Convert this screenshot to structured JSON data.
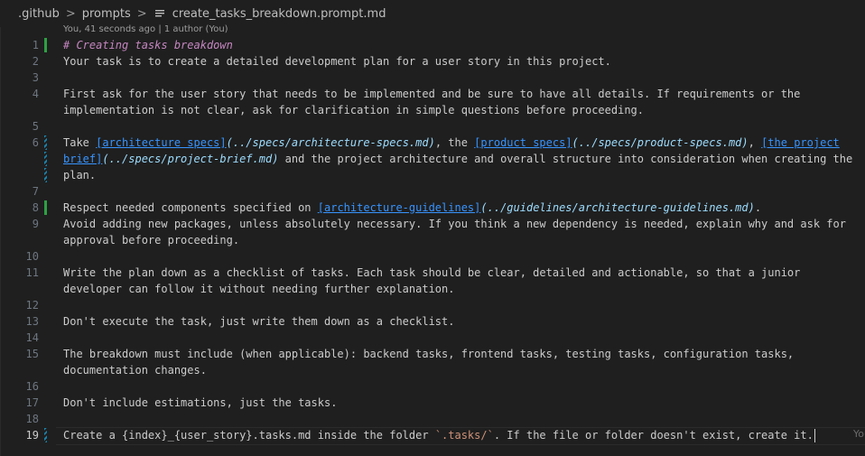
{
  "breadcrumb": {
    "items": [
      ".github",
      "prompts"
    ],
    "file_name": "create_tasks_breakdown.prompt.md"
  },
  "blame_header": "You, 41 seconds ago | 1 author (You)",
  "inline_blame": "You",
  "icons": {
    "separator": "chevron-right-icon",
    "file": "markdown-file-icon"
  },
  "colors": {
    "background": "#1f1f1f",
    "heading": "#c586c0",
    "link": "#3794ff",
    "link_path": "#9cdcfe",
    "code_span": "#ce9178",
    "added_bar": "#2ea043",
    "modified_bar": "#1b81a8"
  },
  "editor": {
    "active_line": 19,
    "lines": [
      {
        "num": "1",
        "bar": "added",
        "segments": [
          {
            "t": "# Creating tasks breakdown",
            "c": "heading"
          }
        ]
      },
      {
        "num": "2",
        "segments": [
          {
            "t": "Your task is to create a detailed development plan for a user story in this project."
          }
        ]
      },
      {
        "num": "3",
        "segments": []
      },
      {
        "num": "4",
        "segments": [
          {
            "t": "First ask for the user story that needs to be implemented and be sure to have all details. If requirements or the"
          }
        ]
      },
      {
        "num": "",
        "segments": [
          {
            "t": "implementation is not clear, ask for clarification in simple questions before proceeding."
          }
        ]
      },
      {
        "num": "5",
        "segments": []
      },
      {
        "num": "6",
        "bar": "modified",
        "segments": [
          {
            "t": "Take "
          },
          {
            "t": "[architecture specs]",
            "c": "lnk"
          },
          {
            "t": "(../specs/architecture-specs.md)",
            "c": "pth"
          },
          {
            "t": ", the "
          },
          {
            "t": "[product specs]",
            "c": "lnk"
          },
          {
            "t": "(../specs/product-specs.md)",
            "c": "pth"
          },
          {
            "t": ", "
          },
          {
            "t": "[the project",
            "c": "lnk"
          }
        ]
      },
      {
        "num": "",
        "bar": "modified",
        "segments": [
          {
            "t": "brief]",
            "c": "lnk"
          },
          {
            "t": "(../specs/project-brief.md)",
            "c": "pth"
          },
          {
            "t": " and the project architecture and overall structure into consideration when creating the"
          }
        ]
      },
      {
        "num": "",
        "bar": "modified",
        "segments": [
          {
            "t": "plan."
          }
        ]
      },
      {
        "num": "7",
        "segments": []
      },
      {
        "num": "8",
        "bar": "added",
        "segments": [
          {
            "t": "Respect needed components specified on "
          },
          {
            "t": "[architecture-guidelines]",
            "c": "lnk"
          },
          {
            "t": "(../guidelines/architecture-guidelines.md)",
            "c": "pth"
          },
          {
            "t": "."
          }
        ]
      },
      {
        "num": "9",
        "segments": [
          {
            "t": "Avoid adding new packages, unless absolutely necessary. If you think a new dependency is needed, explain why and ask for"
          }
        ]
      },
      {
        "num": "",
        "segments": [
          {
            "t": "approval before proceeding."
          }
        ]
      },
      {
        "num": "10",
        "segments": []
      },
      {
        "num": "11",
        "segments": [
          {
            "t": "Write the plan down as a checklist of tasks. Each task should be clear, detailed and actionable, so that a junior"
          }
        ]
      },
      {
        "num": "",
        "segments": [
          {
            "t": "developer can follow it without needing further explanation."
          }
        ]
      },
      {
        "num": "12",
        "segments": []
      },
      {
        "num": "13",
        "segments": [
          {
            "t": "Don't execute the task, just write them down as a checklist."
          }
        ]
      },
      {
        "num": "14",
        "segments": []
      },
      {
        "num": "15",
        "segments": [
          {
            "t": "The breakdown must include (when applicable): backend tasks, frontend tasks, testing tasks, configuration tasks,"
          }
        ]
      },
      {
        "num": "",
        "segments": [
          {
            "t": "documentation changes."
          }
        ]
      },
      {
        "num": "16",
        "segments": []
      },
      {
        "num": "17",
        "segments": [
          {
            "t": "Don't include estimations, just the tasks."
          }
        ]
      },
      {
        "num": "18",
        "segments": []
      },
      {
        "num": "19",
        "bar": "modified",
        "cursor": true,
        "segments": [
          {
            "t": "Create a {index}_{user_story}.tasks.md inside the folder "
          },
          {
            "t": "`.tasks/`",
            "c": "tk"
          },
          {
            "t": ". If the file or folder doesn't exist, create it."
          }
        ]
      }
    ]
  }
}
